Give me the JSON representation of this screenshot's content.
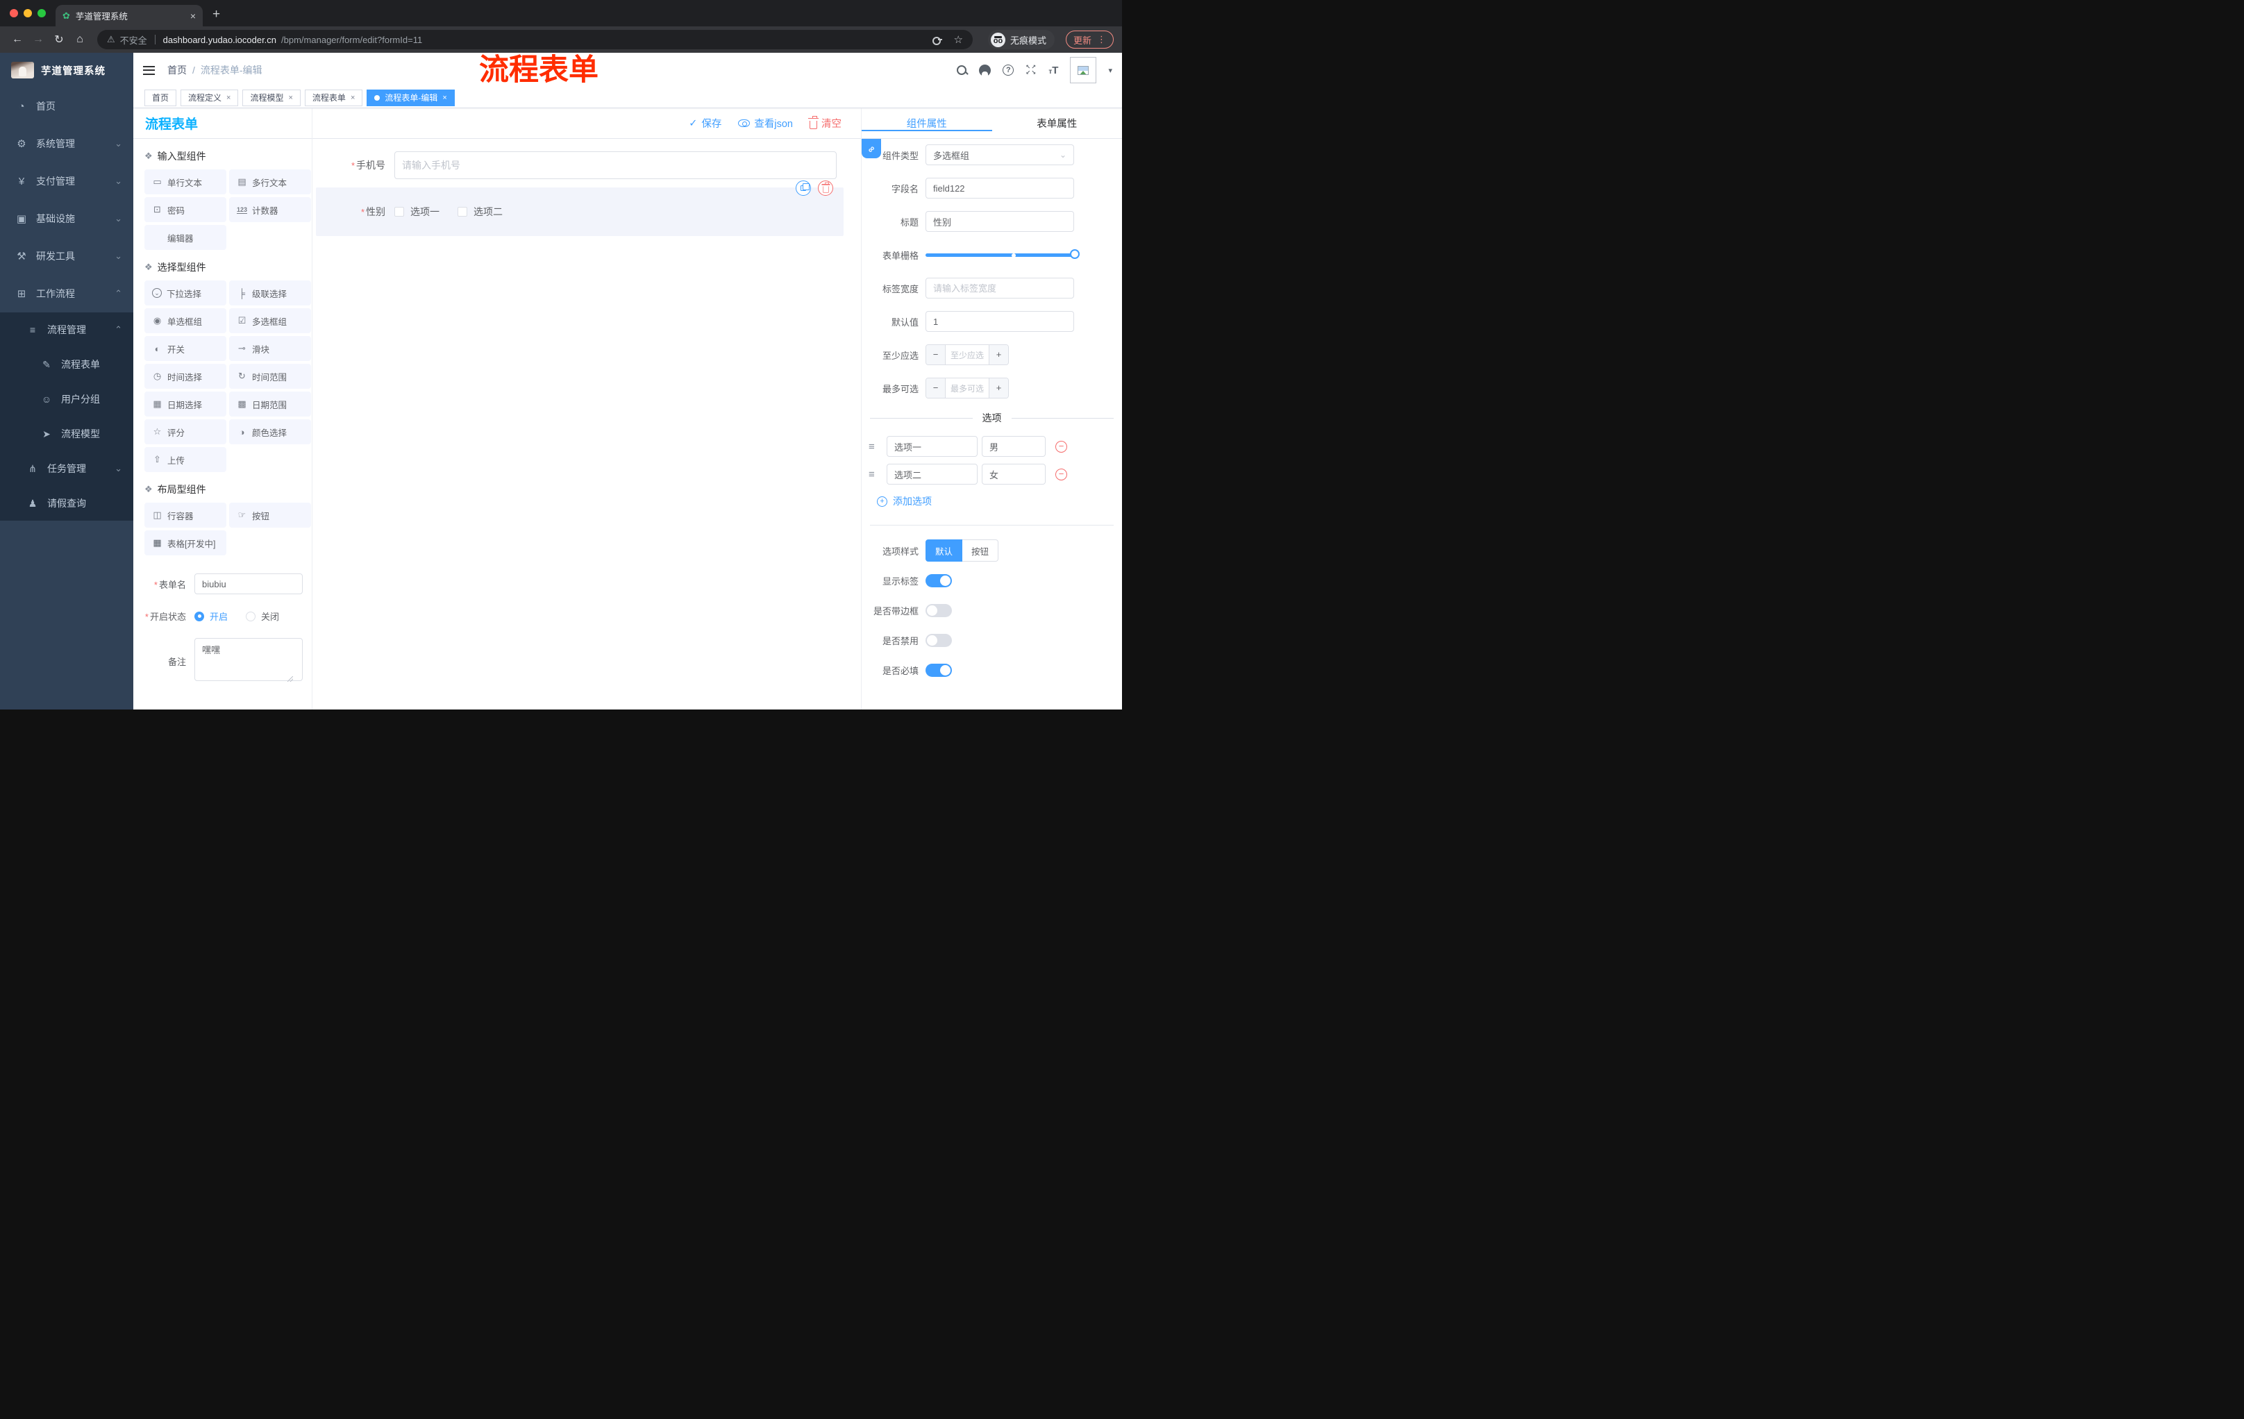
{
  "browser": {
    "tab_title": "芋道管理系统",
    "security_label": "不安全",
    "url_host": "dashboard.yudao.iocoder.cn",
    "url_path": "/bpm/manager/form/edit?formId=11",
    "incognito_label": "无痕模式",
    "update_label": "更新"
  },
  "annotation": {
    "text": "流程表单",
    "color": "#ff2d00"
  },
  "ui": {
    "close": "×",
    "newtab": "+",
    "favicon": "✿",
    "back": "←",
    "forward": "→",
    "reload": "↻",
    "home": "⌂",
    "warning": "⚠",
    "star": "☆",
    "dots": "⋮",
    "caret": "▾",
    "slash": "/",
    "asterisk": "*",
    "check": "✓",
    "minus": "−",
    "plus": "+",
    "chevron_down": "⌄",
    "chain": "∞",
    "fs1": "↖",
    "fs2": "↗",
    "fs3": "↙",
    "fs4": "↘",
    "tt_small": "т",
    "tt_big": "T"
  },
  "sidebar": {
    "logo_title": "芋道管理系统",
    "menu": [
      {
        "glyph": "◔",
        "label": "首页",
        "chev": ""
      },
      {
        "glyph": "⚙",
        "label": "系统管理",
        "chev": "⌄"
      },
      {
        "glyph": "¥",
        "label": "支付管理",
        "chev": "⌄"
      },
      {
        "glyph": "▣",
        "label": "基础设施",
        "chev": "⌄"
      },
      {
        "glyph": "⚒",
        "label": "研发工具",
        "chev": "⌄"
      },
      {
        "glyph": "⊞",
        "label": "工作流程",
        "chev": "⌃"
      }
    ],
    "submenu": [
      {
        "glyph": "≡",
        "label": "流程管理",
        "chev": "⌃"
      },
      {
        "glyph": "✎",
        "label": "流程表单",
        "chev": ""
      },
      {
        "glyph": "☺",
        "label": "用户分组",
        "chev": ""
      },
      {
        "glyph": "➤",
        "label": "流程模型",
        "chev": ""
      },
      {
        "glyph": "⋔",
        "label": "任务管理",
        "chev": "⌄"
      },
      {
        "glyph": "♟",
        "label": "请假查询",
        "chev": ""
      }
    ]
  },
  "header": {
    "breadcrumb_home": "首页",
    "breadcrumb_current": "流程表单-编辑"
  },
  "tabs": [
    {
      "label": "首页"
    },
    {
      "label": "流程定义"
    },
    {
      "label": "流程模型"
    },
    {
      "label": "流程表单"
    },
    {
      "label": "流程表单-编辑"
    }
  ],
  "designer": {
    "panel_title": "流程表单",
    "toolbar": {
      "save": "保存",
      "view_json": "查看json",
      "clear": "清空"
    },
    "groups": [
      {
        "title": "输入型组件",
        "items": [
          {
            "glyph": "▭",
            "label": "单行文本"
          },
          {
            "glyph": "▤",
            "label": "多行文本"
          },
          {
            "glyph": "⊡",
            "label": "密码"
          },
          {
            "glyph": "123",
            "label": "计数器"
          },
          {
            "glyph": "",
            "label": "编辑器"
          }
        ]
      },
      {
        "title": "选择型组件",
        "items": [
          {
            "glyph": "⌄",
            "label": "下拉选择"
          },
          {
            "glyph": "╞",
            "label": "级联选择"
          },
          {
            "glyph": "◉",
            "label": "单选框组"
          },
          {
            "glyph": "☑",
            "label": "多选框组"
          },
          {
            "glyph": "◐",
            "label": "开关"
          },
          {
            "glyph": "⊸",
            "label": "滑块"
          },
          {
            "glyph": "◷",
            "label": "时间选择"
          },
          {
            "glyph": "↻",
            "label": "时间范围"
          },
          {
            "glyph": "▦",
            "label": "日期选择"
          },
          {
            "glyph": "▩",
            "label": "日期范围"
          },
          {
            "glyph": "☆",
            "label": "评分"
          },
          {
            "glyph": "◑",
            "label": "颜色选择"
          },
          {
            "glyph": "⇧",
            "label": "上传"
          }
        ]
      },
      {
        "title": "布局型组件",
        "items": [
          {
            "glyph": "◫",
            "label": "行容器"
          },
          {
            "glyph": "☞",
            "label": "按钮"
          },
          {
            "glyph": "▦",
            "label": "表格[开发中]"
          }
        ]
      }
    ],
    "form": {
      "name_label": "表单名",
      "name_value": "biubiu",
      "status_label": "开启状态",
      "status_on": "开启",
      "status_off": "关闭",
      "remark_label": "备注",
      "remark_value": "嘿嘿"
    },
    "canvas": {
      "phone_label": "手机号",
      "phone_placeholder": "请输入手机号",
      "gender_label": "性别",
      "gender_opt1": "选项一",
      "gender_opt2": "选项二"
    }
  },
  "inspector": {
    "tab_component": "组件属性",
    "tab_form": "表单属性",
    "type_label": "组件类型",
    "type_value": "多选框组",
    "field_label": "字段名",
    "field_value": "field122",
    "title_label": "标题",
    "title_value": "性别",
    "grid_label": "表单栅格",
    "width_label": "标签宽度",
    "width_placeholder": "请输入标签宽度",
    "default_label": "默认值",
    "default_value": "1",
    "min_label": "至少应选",
    "min_placeholder": "至少应选",
    "max_label": "最多可选",
    "max_placeholder": "最多可选",
    "options_title": "选项",
    "options": [
      {
        "label": "选项一",
        "value": "男"
      },
      {
        "label": "选项二",
        "value": "女"
      }
    ],
    "add_option": "添加选项",
    "style_label": "选项样式",
    "style_default": "默认",
    "style_button": "按钮",
    "toggles": [
      {
        "label": "显示标签",
        "on": true
      },
      {
        "label": "是否带边框",
        "on": false
      },
      {
        "label": "是否禁用",
        "on": false
      },
      {
        "label": "是否必填",
        "on": true
      }
    ]
  },
  "colors": {
    "primary": "#409eff",
    "panel_title": "#0bb1ff",
    "danger": "#f56c6c",
    "annotation": "#ff2d00",
    "sidebar_bg": "#304156",
    "submenu_bg": "#1f2d3e",
    "chip_bg": "#f4f6fe",
    "selected_bg": "#f2f4fb",
    "chrome_bg": "#36373b"
  }
}
